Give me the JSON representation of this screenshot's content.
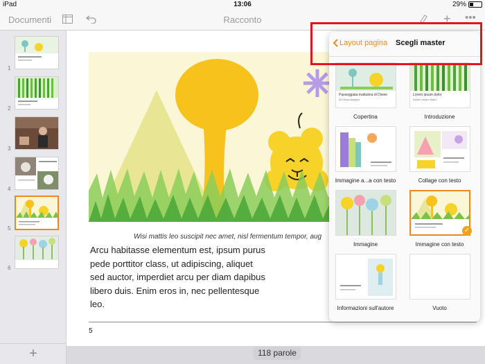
{
  "status_bar": {
    "device": "iPad",
    "time": "13:06",
    "battery": "29%"
  },
  "toolbar": {
    "documents": "Documenti",
    "title": "Racconto"
  },
  "thumbnails": [
    {
      "number": "1"
    },
    {
      "number": "2"
    },
    {
      "number": "3"
    },
    {
      "number": "4"
    },
    {
      "number": "5"
    },
    {
      "number": "6"
    }
  ],
  "page": {
    "caption": "Wisi mattis leo suscipit nec amet, nisl fermentum tempor, aug",
    "body_lines": [
      "Arcu habitasse elementum est, ipsum purus",
      "pede porttitor class, ut adipiscing, aliquet",
      "sed auctor, imperdiet arcu per diam dapibus",
      "libero duis. Enim eros in, nec pellentesque",
      "leo."
    ],
    "page_number": "5"
  },
  "word_count": "118 parole",
  "popover": {
    "back_label": "Layout pagina",
    "title": "Scegli master",
    "masters": [
      {
        "label": "Copertina",
        "preview_title": "Passeggiata mattutina di Dixiee",
        "preview_sub": "Di Olivia Neagon"
      },
      {
        "label": "Introduzione",
        "preview_title": "Lorem ipsum dolor",
        "preview_sub": "Dolore eiusm Maec"
      },
      {
        "label": "Immagine a...a con testo",
        "preview_title": "",
        "preview_sub": ""
      },
      {
        "label": "Collage con testo",
        "preview_title": "",
        "preview_sub": ""
      },
      {
        "label": "Immagine",
        "preview_title": "",
        "preview_sub": ""
      },
      {
        "label": "Immagine con testo",
        "preview_title": "",
        "preview_sub": ""
      },
      {
        "label": "Informazioni sull'autore",
        "preview_title": "",
        "preview_sub": ""
      },
      {
        "label": "Vuoto",
        "preview_title": "",
        "preview_sub": ""
      }
    ]
  },
  "colors": {
    "accent": "#f0861e",
    "highlight": "#e4141c",
    "check": "#f0a21e"
  }
}
